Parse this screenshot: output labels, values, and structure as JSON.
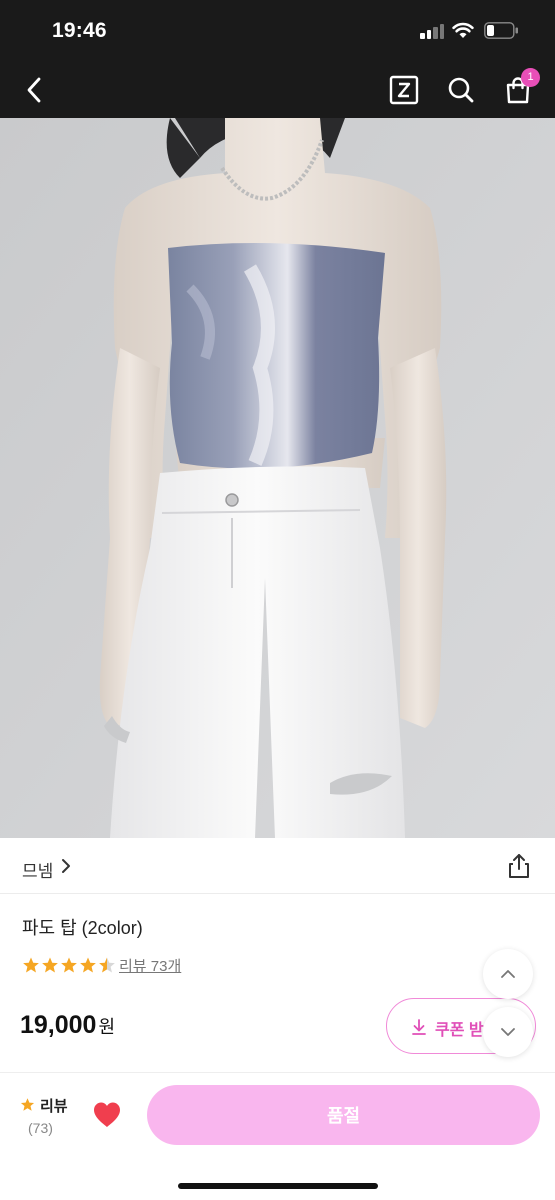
{
  "status_bar": {
    "time": "19:46"
  },
  "nav": {
    "back_icon": "chevron-left-icon",
    "z_icon": "z-logo-icon",
    "search_icon": "search-icon",
    "cart_icon": "shopping-bag-icon",
    "cart_badge": "1"
  },
  "product": {
    "shop_name": "므넴",
    "title": "파도 탑 (2color)",
    "rating": 4.5,
    "rating_max": 5,
    "review_link": "리뷰 73개",
    "price": "19,000",
    "price_unit": "원",
    "coupon_label": "쿠폰 받"
  },
  "bottom_bar": {
    "review_label": "리뷰",
    "review_count": "(73)",
    "buy_label": "품절"
  },
  "colors": {
    "accent_pink": "#e04fb8",
    "buy_button_pink": "#f9b6ee",
    "badge_pink": "#e84fb8",
    "star_orange": "#f5a623",
    "heart_red": "#f03e4e"
  }
}
